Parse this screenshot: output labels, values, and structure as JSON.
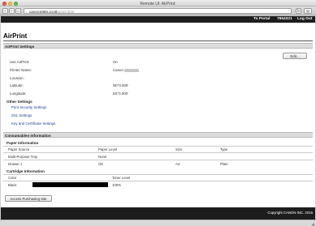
{
  "window": {
    "title": "Remote UI: AirPrint:"
  },
  "browser": {
    "address_host": "canon1689c.local",
    "address_path": "/airprint.html",
    "back_icon": "‹",
    "forward_icon": "›",
    "home_icon": "⌂",
    "reload_icon": "↻",
    "sidebar_icon": "▤"
  },
  "topbar": {
    "portal": "To Portal",
    "user": "7654321",
    "logout": "Log Out"
  },
  "page": {
    "title": "AirPrint"
  },
  "airprint_settings": {
    "header": "AirPrint Settings",
    "edit_button": "Edit...",
    "rows": [
      {
        "label": "Use AirPrint:",
        "value": "On"
      },
      {
        "label": "Printer Name:",
        "value": "Canon"
      },
      {
        "label": "Location:",
        "value": ""
      },
      {
        "label": "Latitude:",
        "value": "N0°0.000'"
      },
      {
        "label": "Longitude:",
        "value": "E0°0.000'"
      }
    ]
  },
  "other_settings": {
    "header": "Other Settings",
    "links": [
      "Print Security Settings",
      "SSL Settings",
      "Key and Certificate Settings"
    ]
  },
  "consumables": {
    "header": "Consumables Information",
    "paper": {
      "header": "Paper Information",
      "columns": [
        "Paper Source",
        "Paper Level",
        "Size",
        "Type"
      ],
      "rows": [
        [
          "Multi-Purpose Tray",
          "None",
          "",
          ""
        ],
        [
          "Drawer 1",
          "OK",
          "A4",
          "Plain"
        ]
      ]
    },
    "cartridge": {
      "header": "Cartridge Information",
      "columns": [
        "Color",
        "Toner Level"
      ],
      "rows": [
        {
          "color": "Black",
          "level_text": "100%",
          "level_fraction": 1.0,
          "bar_color": "#000000"
        }
      ]
    },
    "purchase_button": "Access Purchasing Site"
  },
  "footer": {
    "copyright": "Copyright CANON INC. 2015"
  }
}
